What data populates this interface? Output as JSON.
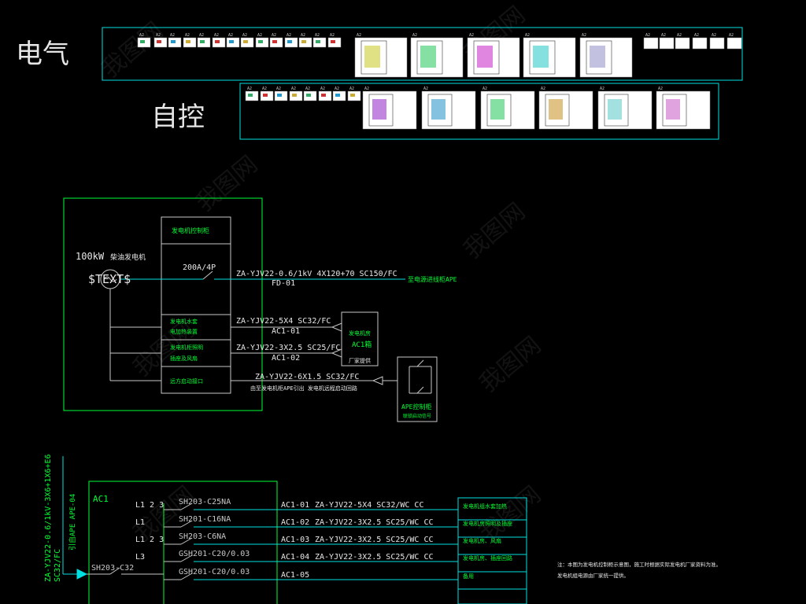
{
  "sections": {
    "electrical_label": "电气",
    "automation_label": "自控"
  },
  "sheet_tag": "A2",
  "watermark": "我图网",
  "colors": {
    "cyan": "#00e0e0",
    "white": "#e8e8e8",
    "green": "#00ff33",
    "line": "#c8c8c8"
  },
  "generator": {
    "power": "100kW",
    "power_desc": "柴油发电机",
    "symbol_text": "$TEXT$",
    "panel_title": "发电机控制柜",
    "breaker": "200A/4P",
    "main_cable": "ZA-YJV22-0.6/1kV 4X120+70 SC150/FC",
    "main_circuit": "FD-01",
    "main_dest": "至电源进线柜APE",
    "rows": [
      {
        "label1": "发电机水套",
        "label2": "电加热装置",
        "cable": "ZA-YJV22-5X4 SC32/FC",
        "circuit": "AC1-01"
      },
      {
        "label1": "发电机柜照明",
        "label2": "插座及风扇",
        "cable": "ZA-YJV22-3X2.5 SC25/FC",
        "circuit": "AC1-02"
      },
      {
        "label1": "远方启动接口",
        "label2": "",
        "cable": "ZA-YJV22-6X1.5 SC32/FC",
        "circuit": ""
      }
    ],
    "ac1_box": {
      "line1": "发电机房",
      "line2": "AC1箱",
      "line3": "厂家提供"
    },
    "start_note": "由至发电机柜APE引出  发电机远程启动回路",
    "ape_box": {
      "label1": "APE控制柜",
      "label2": "联锁启动信号"
    }
  },
  "ac1": {
    "title": "AC1",
    "incoming_cable": "ZA-YJV22-0.6/1kV-3X6+1X6+E6",
    "incoming_conduit": "SC32/FC",
    "incoming_source": "引自APE APE-04",
    "main_breaker": "SH203-C32",
    "circuits": [
      {
        "phase": "L1 2 3",
        "breaker": "SH203-C25NA",
        "id": "AC1-01",
        "cable": "ZA-YJV22-5X4 SC32/WC CC",
        "load": "发电机组水套加热"
      },
      {
        "phase": "L1",
        "breaker": "SH201-C16NA",
        "id": "AC1-02",
        "cable": "ZA-YJV22-3X2.5 SC25/WC CC",
        "load": "发电机房照明及插座"
      },
      {
        "phase": "L1 2 3",
        "breaker": "SH203-C6NA",
        "id": "AC1-03",
        "cable": "ZA-YJV22-3X2.5 SC25/WC CC",
        "load": "发电机房、风扇"
      },
      {
        "phase": "L3",
        "breaker": "GSH201-C20/0.03",
        "id": "AC1-04",
        "cable": "ZA-YJV22-3X2.5 SC25/WC CC",
        "load": "发电机房、插座回路"
      },
      {
        "phase": "",
        "breaker": "GSH201-C20/0.03",
        "id": "AC1-05",
        "cable": "",
        "load": "备用"
      }
    ],
    "note1": "注：本图为发电机控制柜示意图，施工时根据实际发电机厂家资料为准。",
    "note2": "发电机组电源由厂家统一提供。"
  }
}
